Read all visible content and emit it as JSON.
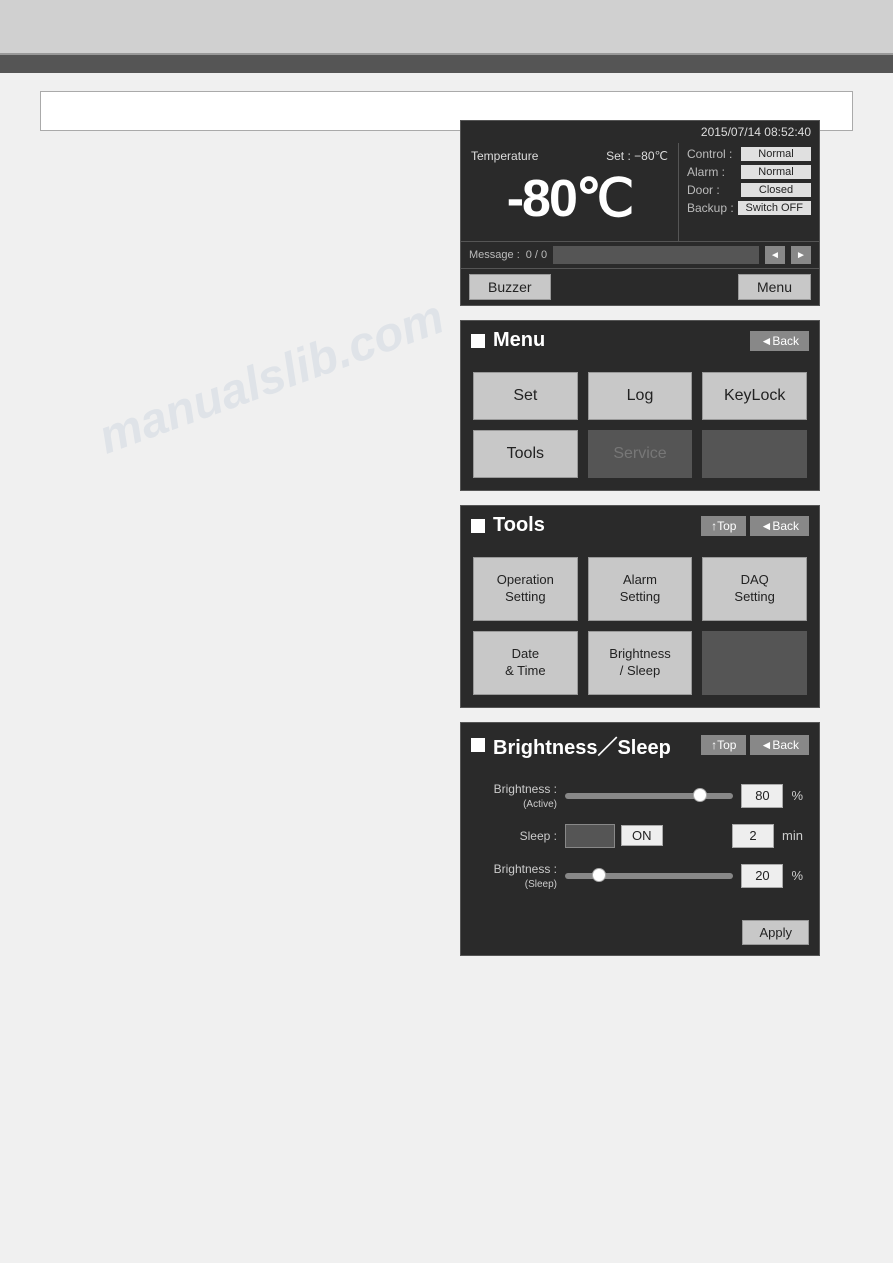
{
  "topbar": {},
  "searchbar": {
    "placeholder": ""
  },
  "datetime": "2015/07/14  08:52:40",
  "panel1": {
    "temp_label": "Temperature",
    "set_label": "Set :",
    "set_value": "−80℃",
    "temp_display": "-80℃",
    "control_label": "Control :",
    "control_value": "Normal",
    "alarm_label": "Alarm  :",
    "alarm_value": "Normal",
    "door_label": "Door   :",
    "door_value": "Closed",
    "backup_label": "Backup :",
    "backup_value": "Switch OFF",
    "message_label": "Message :",
    "message_count": "0 / 0",
    "buzzer_label": "Buzzer",
    "menu_label": "Menu"
  },
  "panel2": {
    "title": "Menu",
    "back_label": "◄Back",
    "btn_set": "Set",
    "btn_log": "Log",
    "btn_keylock": "KeyLock",
    "btn_tools": "Tools",
    "btn_service": "Service",
    "btn_empty": ""
  },
  "panel3": {
    "title": "Tools",
    "top_label": "↑Top",
    "back_label": "◄Back",
    "btn_operation": "Operation\nSetting",
    "btn_alarm": "Alarm\nSetting",
    "btn_daq": "DAQ\nSetting",
    "btn_datetime": "Date\n& Time",
    "btn_brightness": "Brightness\n/ Sleep",
    "btn_empty": ""
  },
  "panel4": {
    "title": "Brightness／Sleep",
    "top_label": "↑Top",
    "back_label": "◄Back",
    "brightness_active_label": "Brightness :\n(Active)",
    "brightness_active_value": "80",
    "brightness_active_unit": "%",
    "sleep_label": "Sleep :",
    "sleep_on": "ON",
    "sleep_value": "2",
    "sleep_unit": "min",
    "brightness_sleep_label": "Brightness :\n(Sleep)",
    "brightness_sleep_value": "20",
    "brightness_sleep_unit": "%",
    "apply_label": "Apply"
  },
  "watermark": "manualslib.com"
}
